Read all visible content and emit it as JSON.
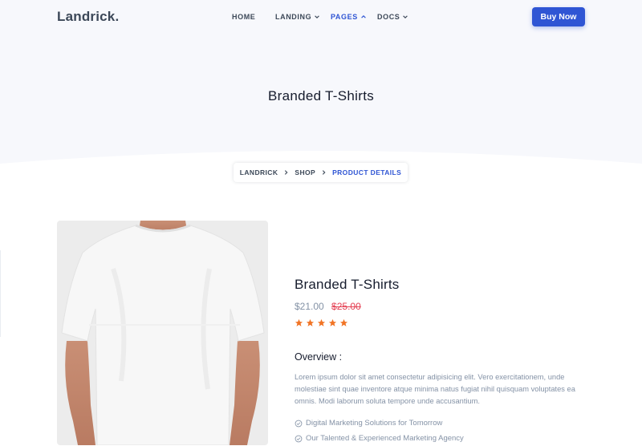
{
  "header": {
    "logo": "Landrick.",
    "nav": [
      {
        "label": "HOME",
        "dropdown": false,
        "active": false
      },
      {
        "label": "LANDING",
        "dropdown": true,
        "active": false
      },
      {
        "label": "PAGES",
        "dropdown": true,
        "active": true
      },
      {
        "label": "DOCS",
        "dropdown": true,
        "active": false
      }
    ],
    "buy_label": "Buy Now"
  },
  "hero": {
    "title": "Branded T-Shirts",
    "breadcrumb": [
      "LANDRICK",
      "SHOP",
      "PRODUCT DETAILS"
    ]
  },
  "product": {
    "title": "Branded T-Shirts",
    "price": "$21.00",
    "old_price": "$25.00",
    "rating": 5,
    "rating_max": 5,
    "overview_heading": "Overview :",
    "description": "Lorem ipsum dolor sit amet consectetur adipisicing elit. Vero exercitationem, unde molestiae sint quae inventore atque minima natus fugiat nihil quisquam voluptates ea omnis. Modi laborum soluta tempore unde accusantium.",
    "features": [
      "Digital Marketing Solutions for Tomorrow",
      "Our Talented & Experienced Marketing Agency"
    ]
  },
  "colors": {
    "primary": "#2f55d4",
    "heading": "#161c2d",
    "muted": "#8492a6",
    "danger": "#e43f52",
    "star": "#f17425",
    "hero_bg": "#f7f8fc"
  },
  "icons": {
    "nav_dropdown": "chevron-down-icon",
    "nav_dropdown_active": "chevron-up-icon",
    "breadcrumb_separator": "chevron-right-icon",
    "rating": "star-icon",
    "feature_bullet": "check-circle-icon"
  }
}
